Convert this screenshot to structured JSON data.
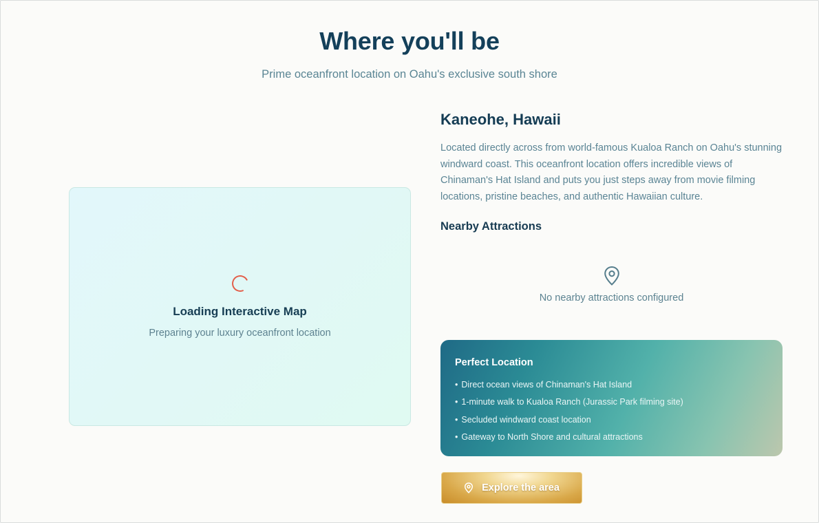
{
  "section": {
    "title": "Where you'll be",
    "subtitle": "Prime oceanfront location on Oahu's exclusive south shore"
  },
  "map": {
    "loading_title": "Loading Interactive Map",
    "loading_subtitle": "Preparing your luxury oceanfront location"
  },
  "location": {
    "title": "Kaneohe, Hawaii",
    "description": "Located directly across from world-famous Kualoa Ranch on Oahu's stunning windward coast. This oceanfront location offers incredible views of Chinaman's Hat Island and puts you just steps away from movie filming locations, pristine beaches, and authentic Hawaiian culture."
  },
  "nearby": {
    "title": "Nearby Attractions",
    "empty_text": "No nearby attractions configured",
    "icon": "map-pin-icon"
  },
  "perfect_location": {
    "title": "Perfect Location",
    "items": [
      "Direct ocean views of Chinaman's Hat Island",
      "1-minute walk to Kualoa Ranch (Jurassic Park filming site)",
      "Secluded windward coast location",
      "Gateway to North Shore and cultural attractions"
    ]
  },
  "explore_button": {
    "label": "Explore the area",
    "icon": "map-pin-icon"
  },
  "colors": {
    "title": "#14405a",
    "spinner": "#e35f4a",
    "gold": "#d9a849",
    "teal": "#2b8b95"
  }
}
